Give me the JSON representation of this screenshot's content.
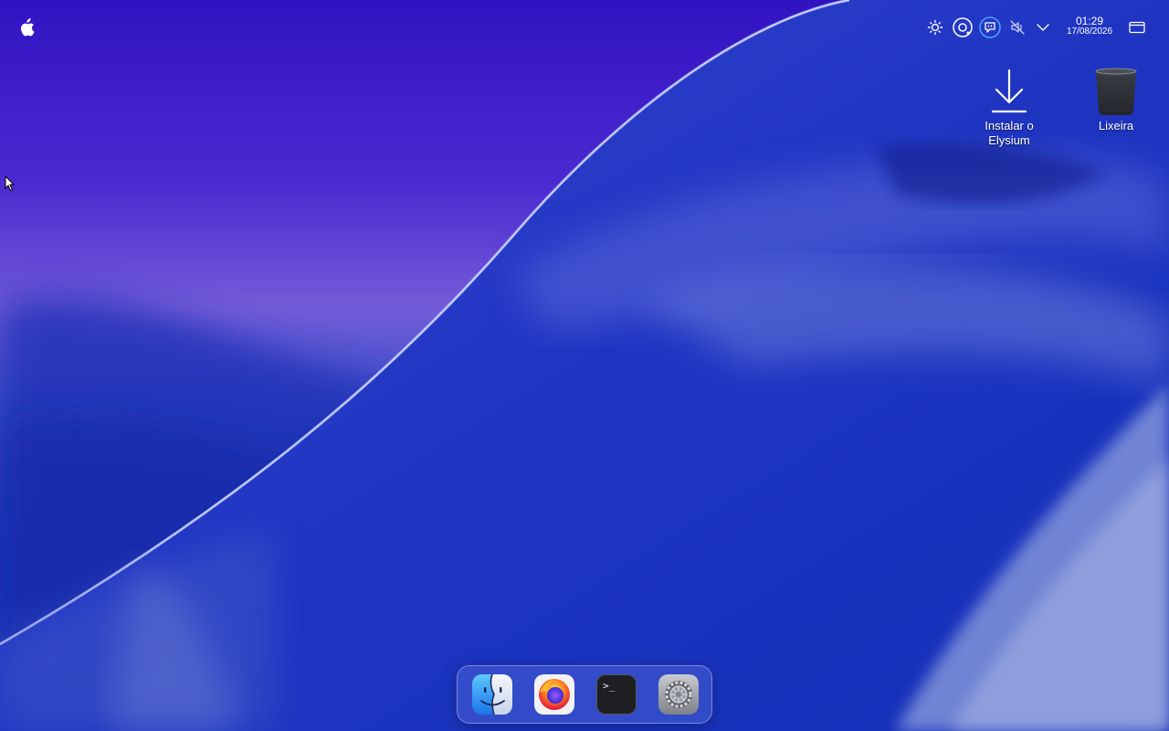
{
  "menubar": {
    "apple_icon": "apple-logo-icon",
    "tray_icons": [
      {
        "name": "brightness-icon"
      },
      {
        "name": "screen-record-icon"
      },
      {
        "name": "chat-bubble-icon"
      },
      {
        "name": "volume-muted-icon"
      },
      {
        "name": "chevron-down-icon"
      }
    ],
    "clock": {
      "time": "01:29",
      "date": "17/08/2026"
    },
    "window_icon": "show-desktop-icon"
  },
  "desktop": {
    "icons": [
      {
        "label": "Instalar o Elysium",
        "icon": "download-arrow-icon"
      },
      {
        "label": "Lixeira",
        "icon": "trash-bin-icon"
      }
    ]
  },
  "dock": {
    "apps": [
      {
        "name": "finder",
        "icon": "finder-icon"
      },
      {
        "name": "firefox",
        "icon": "firefox-icon"
      },
      {
        "name": "terminal",
        "icon": "terminal-icon",
        "glyph": ">_"
      },
      {
        "name": "settings",
        "icon": "settings-gear-icon"
      }
    ]
  },
  "colors": {
    "wallpaper_top": "#3a14c8",
    "wallpaper_mid": "#6a4fd6",
    "wallpaper_blue": "#1e36c4",
    "accent_ring": "#4aa0ff"
  }
}
